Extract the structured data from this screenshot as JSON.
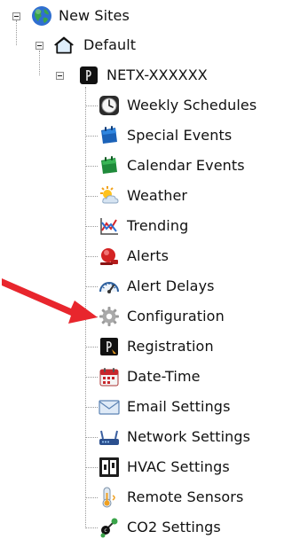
{
  "tree": {
    "root": {
      "label": "New Sites",
      "icon": "globe-icon",
      "expanded": true
    },
    "site": {
      "label": "Default",
      "icon": "house-icon",
      "expanded": true
    },
    "device": {
      "label": "NETX-XXXXXX",
      "icon": "device-logo-icon",
      "expanded": true
    },
    "items": [
      {
        "label": "Weekly Schedules",
        "icon": "clock-icon"
      },
      {
        "label": "Special Events",
        "icon": "blue-calendar-icon"
      },
      {
        "label": "Calendar Events",
        "icon": "green-calendar-icon"
      },
      {
        "label": "Weather",
        "icon": "sun-cloud-icon"
      },
      {
        "label": "Trending",
        "icon": "trend-chart-icon"
      },
      {
        "label": "Alerts",
        "icon": "alarm-bell-icon"
      },
      {
        "label": "Alert Delays",
        "icon": "gauge-icon"
      },
      {
        "label": "Configuration",
        "icon": "gear-icon"
      },
      {
        "label": "Registration",
        "icon": "registration-logo-icon"
      },
      {
        "label": "Date-Time",
        "icon": "date-calendar-icon"
      },
      {
        "label": "Email Settings",
        "icon": "envelope-icon"
      },
      {
        "label": "Network Settings",
        "icon": "router-icon"
      },
      {
        "label": "HVAC Settings",
        "icon": "hvac-panel-icon"
      },
      {
        "label": "Remote Sensors",
        "icon": "thermometer-icon"
      },
      {
        "label": "CO2 Settings",
        "icon": "co2-molecule-icon"
      }
    ]
  },
  "colors": {
    "arrow": "#e8262d",
    "text": "#111111",
    "connector": "#9a9a9a"
  }
}
